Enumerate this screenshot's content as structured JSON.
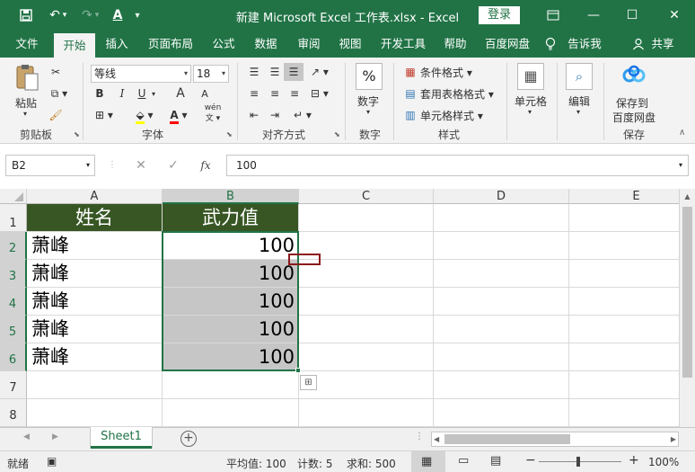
{
  "titlebar": {
    "title": "新建 Microsoft Excel 工作表.xlsx  -  Excel",
    "login": "登录",
    "undo_arrow": "▾",
    "redo_arrow": "▾",
    "font_color_glyph": "A",
    "more_glyph": "▾"
  },
  "tabs": [
    "文件",
    "开始",
    "插入",
    "页面布局",
    "公式",
    "数据",
    "审阅",
    "视图",
    "开发工具",
    "帮助",
    "百度网盘",
    "告诉我",
    "共享"
  ],
  "ribbon": {
    "clipboard": {
      "label": "剪贴板",
      "paste": "粘贴"
    },
    "font": {
      "label": "字体",
      "name": "等线",
      "size": "18",
      "bold": "B",
      "italic": "I",
      "underline": "U",
      "grow": "A",
      "shrink": "A",
      "phonetic": "wén"
    },
    "alignment": {
      "label": "对齐方式"
    },
    "number": {
      "label": "数字",
      "button": "数字",
      "glyph": "%"
    },
    "styles": {
      "label": "样式",
      "conditional": "条件格式",
      "table": "套用表格格式",
      "cell": "单元格样式"
    },
    "cells": {
      "button": "单元格"
    },
    "editing": {
      "button": "编辑"
    },
    "baidu": {
      "label": "保存",
      "line1": "保存到",
      "line2": "百度网盘"
    }
  },
  "formula_bar": {
    "name_box": "B2",
    "value": "100",
    "fx": "fx"
  },
  "grid": {
    "columns": [
      "A",
      "B",
      "C",
      "D",
      "E"
    ],
    "rows": [
      "1",
      "2",
      "3",
      "4",
      "5",
      "6",
      "7",
      "8"
    ],
    "header": [
      "姓名",
      "武力值"
    ],
    "data": [
      [
        "萧峰",
        "100"
      ],
      [
        "萧峰",
        "100"
      ],
      [
        "萧峰",
        "100"
      ],
      [
        "萧峰",
        "100"
      ],
      [
        "萧峰",
        "100"
      ]
    ]
  },
  "sheets": {
    "active": "Sheet1",
    "add": "+"
  },
  "statusbar": {
    "mode": "就绪",
    "average": "平均值: 100",
    "count": "计数: 5",
    "sum": "求和: 500",
    "zoom": "100%"
  },
  "colors": {
    "accent": "#217346",
    "header_fill": "#375623",
    "selection_fill": "#c6c6c6"
  }
}
